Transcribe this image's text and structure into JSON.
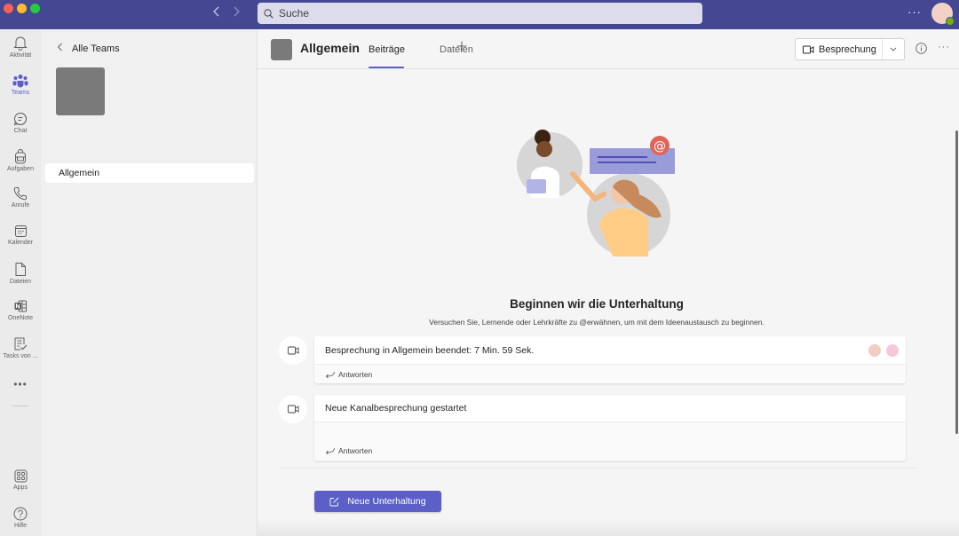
{
  "titlebar": {
    "search_placeholder": "Suche",
    "more_label": "···",
    "back_icon": "chevron-left-icon",
    "forward_icon": "chevron-right-icon",
    "presence_status": "available",
    "colors": {
      "bar": "#444791",
      "search": "#dcdcec",
      "avatar": "#f2d2c6",
      "presence": "#6bb700"
    }
  },
  "rail": {
    "items": [
      {
        "label": "Aktivität",
        "icon": "bell-icon",
        "active": false
      },
      {
        "label": "Teams",
        "icon": "teams-icon",
        "active": true
      },
      {
        "label": "Chat",
        "icon": "chat-icon",
        "active": false
      },
      {
        "label": "Aufgaben",
        "icon": "backpack-icon",
        "active": false
      },
      {
        "label": "Anrufe",
        "icon": "phone-icon",
        "active": false
      },
      {
        "label": "Kalender",
        "icon": "calendar-icon",
        "active": false
      },
      {
        "label": "Dateien",
        "icon": "file-icon",
        "active": false
      },
      {
        "label": "OneNote",
        "icon": "onenote-icon",
        "active": false
      },
      {
        "label": "Tasks von ...",
        "icon": "tasks-icon",
        "active": false
      }
    ],
    "more_label": "•••",
    "bottom_items": [
      {
        "label": "Apps",
        "icon": "apps-icon"
      },
      {
        "label": "Hilfe",
        "icon": "help-icon"
      }
    ],
    "accent": "#5b5fc7"
  },
  "team_panel": {
    "back_label": "Alle Teams",
    "channels": [
      {
        "label": "Allgemein",
        "selected": true
      }
    ]
  },
  "channel_header": {
    "title": "Allgemein",
    "tabs": [
      {
        "label": "Beiträge",
        "active": true
      },
      {
        "label": "Dateien",
        "active": false
      }
    ],
    "add_tab_label": "+",
    "meet_button_label": "Besprechung",
    "more_label": "···"
  },
  "main": {
    "empty_state": {
      "title": "Beginnen wir die Unterhaltung",
      "subtitle": "Versuchen Sie, Lernende oder Lehrkräfte zu @erwähnen, um mit dem Ideenaustausch zu beginnen."
    },
    "posts": [
      {
        "message": "Besprechung in Allgemein beendet: 7 Min. 59 Sek.",
        "reply_label": "Antworten",
        "icon": "video-camera-icon",
        "participant_colors": [
          "#f1cdc3",
          "#f4c9d7"
        ]
      },
      {
        "message": "Neue Kanalbesprechung gestartet",
        "reply_label": "Antworten",
        "icon": "video-camera-icon"
      }
    ],
    "new_conversation_label": "Neue Unterhaltung",
    "accent": "#5b5fc7"
  }
}
